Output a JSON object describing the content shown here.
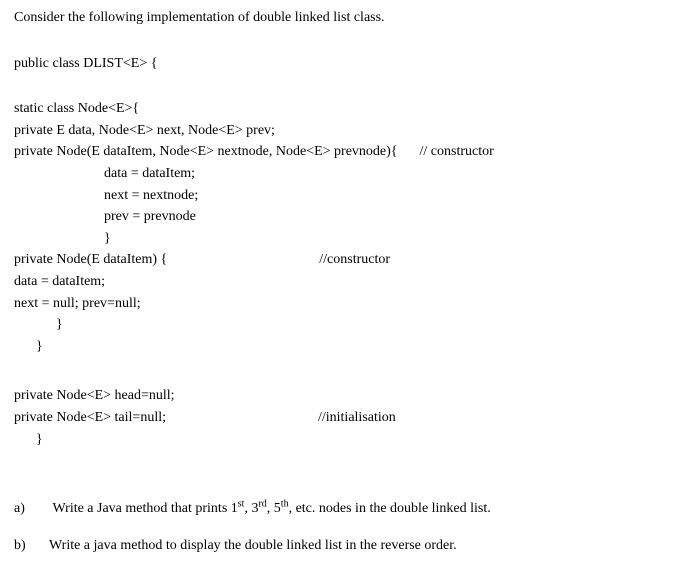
{
  "intro": "Consider the following implementation of double linked list class.",
  "class_decl": "public class DLIST<E> {",
  "node": {
    "decl": "static class Node<E>{",
    "fields": "private E data, Node<E> next, Node<E> prev;",
    "ctor1_sig": "private Node(E dataItem, Node<E> nextnode, Node<E> prevnode){",
    "ctor1_comment": "// constructor",
    "ctor1_l1": "data = dataItem;",
    "ctor1_l2": "next = nextnode;",
    "ctor1_l3": "prev = prevnode",
    "ctor1_close": "}",
    "ctor2_sig": "private Node(E dataItem) {",
    "ctor2_comment": "//constructor",
    "ctor2_l1": "data = dataItem;",
    "ctor2_l2": "next = null; prev=null;",
    "ctor2_close": "}",
    "node_close": "}"
  },
  "list": {
    "head": "private Node<E> head=null;",
    "tail": "private Node<E> tail=null;",
    "tail_comment": "//initialisation",
    "close": "}"
  },
  "questions": {
    "a_label": "a)",
    "a_text_pre": "Write a Java method that prints 1",
    "a_sup1": "st",
    "a_mid1": ", 3",
    "a_sup2": "rd",
    "a_mid2": ", 5",
    "a_sup3": "th",
    "a_text_post": ", etc. nodes in the double linked list.",
    "b_label": "b)",
    "b_text": "Write a java method to display the double linked list in the reverse order."
  }
}
